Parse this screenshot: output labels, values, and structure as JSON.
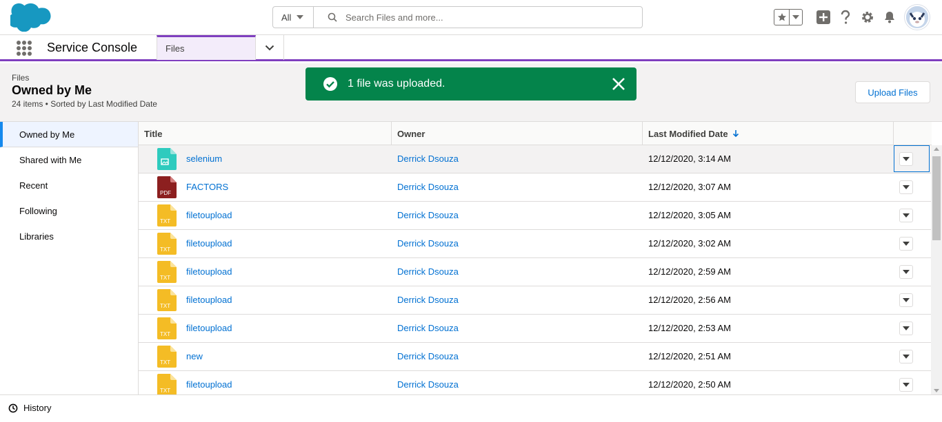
{
  "global_header": {
    "search_scope": "All",
    "search_placeholder": "Search Files and more..."
  },
  "app_nav": {
    "app_name": "Service Console",
    "tabs": [
      {
        "label": "Files"
      }
    ]
  },
  "page_header": {
    "object_label": "Files",
    "title": "Owned by Me",
    "meta": "24 items • Sorted by Last Modified Date",
    "upload_button": "Upload Files"
  },
  "toast": {
    "message": "1 file was uploaded.",
    "color": "#04844b"
  },
  "sidebar": {
    "items": [
      {
        "label": "Owned by Me",
        "active": true
      },
      {
        "label": "Shared with Me"
      },
      {
        "label": "Recent"
      },
      {
        "label": "Following"
      },
      {
        "label": "Libraries"
      }
    ]
  },
  "table": {
    "columns": [
      "Title",
      "Owner",
      "Last Modified Date",
      ""
    ],
    "sort_indicator": "arrow-down-icon",
    "rows": [
      {
        "title": "selenium",
        "type": "image",
        "owner": "Derrick Dsouza",
        "modified": "12/12/2020, 3:14 AM",
        "selected": true
      },
      {
        "title": "FACTORS",
        "type": "pdf",
        "owner": "Derrick Dsouza",
        "modified": "12/12/2020, 3:07 AM"
      },
      {
        "title": "filetoupload",
        "type": "txt",
        "owner": "Derrick Dsouza",
        "modified": "12/12/2020, 3:05 AM"
      },
      {
        "title": "filetoupload",
        "type": "txt",
        "owner": "Derrick Dsouza",
        "modified": "12/12/2020, 3:02 AM"
      },
      {
        "title": "filetoupload",
        "type": "txt",
        "owner": "Derrick Dsouza",
        "modified": "12/12/2020, 2:59 AM"
      },
      {
        "title": "filetoupload",
        "type": "txt",
        "owner": "Derrick Dsouza",
        "modified": "12/12/2020, 2:56 AM"
      },
      {
        "title": "filetoupload",
        "type": "txt",
        "owner": "Derrick Dsouza",
        "modified": "12/12/2020, 2:53 AM"
      },
      {
        "title": "new",
        "type": "txt",
        "owner": "Derrick Dsouza",
        "modified": "12/12/2020, 2:51 AM"
      },
      {
        "title": "filetoupload",
        "type": "txt",
        "owner": "Derrick Dsouza",
        "modified": "12/12/2020, 2:50 AM"
      }
    ],
    "file_icon_labels": {
      "pdf": "PDF",
      "txt": "TXT"
    }
  },
  "utility_bar": {
    "history_label": "History"
  },
  "colors": {
    "brand": "#1798c1",
    "link": "#0070d2",
    "nav_accent": "#7f3fbf",
    "pdf": "#8c1f1f",
    "txt": "#f4bc25",
    "image": "#2ecbbe"
  }
}
